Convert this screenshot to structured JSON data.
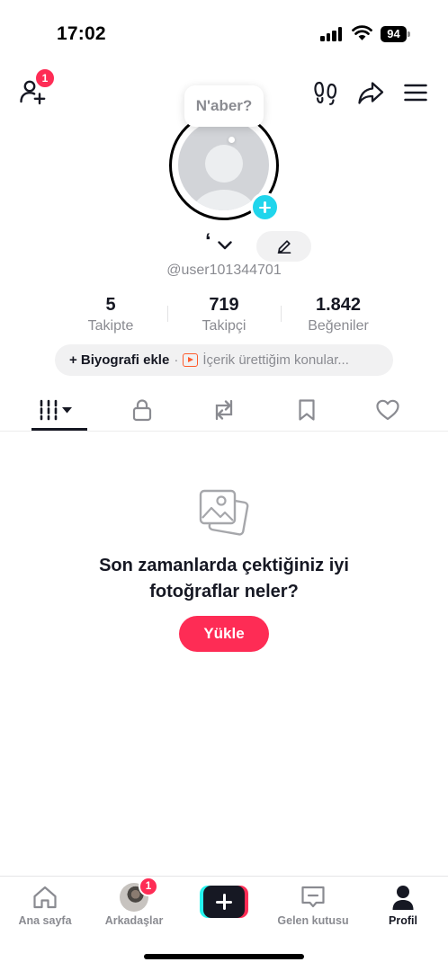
{
  "status_bar": {
    "time": "17:02",
    "battery": "94",
    "icons": [
      "signal-icon",
      "wifi-icon",
      "battery-icon"
    ]
  },
  "header": {
    "add_friend_badge": "1",
    "icons": [
      "add-friend-icon",
      "footprint-icon",
      "share-icon",
      "menu-icon"
    ]
  },
  "profile": {
    "bubble_text": "N'aber?",
    "display_name": "‘",
    "username": "@user101344701"
  },
  "stats": {
    "following_value": "5",
    "following_label": "Takipte",
    "followers_value": "719",
    "followers_label": "Takipçi",
    "likes_value": "1.842",
    "likes_label": "Beğeniler"
  },
  "bio": {
    "add_bio": "+ Biyografi ekle",
    "separator": "·",
    "topics": "İçerik ürettiğim konular..."
  },
  "tabs": [
    "videos-grid",
    "private",
    "reposts",
    "favorites",
    "liked"
  ],
  "empty_state": {
    "title_line1": "Son zamanlarda çektiğiniz iyi",
    "title_line2": "fotoğraflar neler?",
    "upload_label": "Yükle"
  },
  "bottom_nav": {
    "home_label": "Ana sayfa",
    "friends_label": "Arkadaşlar",
    "friends_badge": "1",
    "inbox_label": "Gelen kutusu",
    "profile_label": "Profil"
  },
  "colors": {
    "accent": "#fe2c55",
    "cyan": "#20d5ec",
    "text_primary": "#161823",
    "text_secondary": "#8a8b91"
  }
}
